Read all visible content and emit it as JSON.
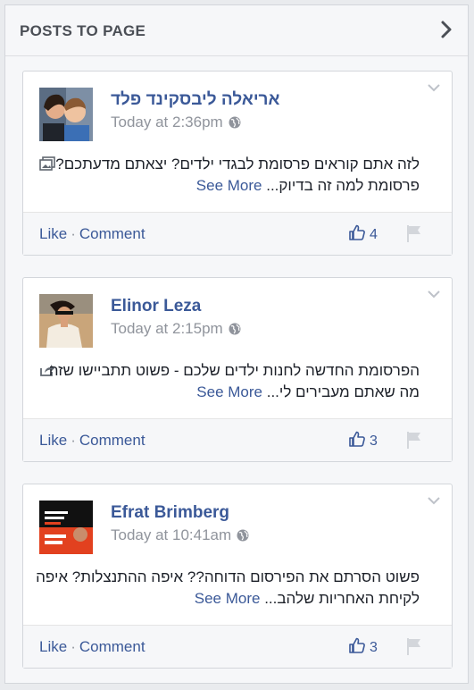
{
  "panel": {
    "title": "POSTS TO PAGE",
    "expand_icon": "chevron-right-icon"
  },
  "posts": [
    {
      "author": "אריאלה ליבסקינד פלד",
      "time": "Today at 2:36pm",
      "privacy_icon": "globe-icon",
      "type_icon": "photo-icon",
      "body_line1": "לזה אתם קוראים פרסומת לבגדי ילדים? יצאתם מדעתכם?",
      "body_line2": "פרסומת למה זה בדיוק...",
      "see_more": "See More",
      "like_label": "Like",
      "comment_label": "Comment",
      "like_count": "4",
      "avatar_colors": {
        "bg": "#6a7f96",
        "skin": "#e8b795",
        "hair": "#2b1d14",
        "shirt": "#3b6fb5"
      }
    },
    {
      "author": "Elinor Leza",
      "time": "Today at 2:15pm",
      "privacy_icon": "globe-icon",
      "type_icon": "share-icon",
      "body_line1": "הפרסומת החדשה לחנות ילדים שלכם - פשוט תתביישו שזה",
      "body_line2": "מה שאתם מעבירים לי...",
      "see_more": "See More",
      "like_label": "Like",
      "comment_label": "Comment",
      "like_count": "3",
      "avatar_colors": {
        "bg": "#c9a57a",
        "skin": "#d9a07a",
        "hair": "#1e1410",
        "shirt": "#f3ece0"
      }
    },
    {
      "author": "Efrat Brimberg",
      "time": "Today at 10:41am",
      "privacy_icon": "globe-icon",
      "type_icon": "",
      "body_line1": "פשוט הסרתם את הפירסום הדוחה?? איפה ההתנצלות? איפה",
      "body_line2": "לקיחת האחריות שלהב...",
      "see_more": "See More",
      "like_label": "Like",
      "comment_label": "Comment",
      "like_count": "3",
      "avatar_colors": {
        "bg": "#111111",
        "accent": "#e2411f",
        "text": "#ffffff"
      }
    }
  ],
  "colors": {
    "link": "#3b5998",
    "meta": "#90949c",
    "footer_bg": "#f6f7f9"
  }
}
